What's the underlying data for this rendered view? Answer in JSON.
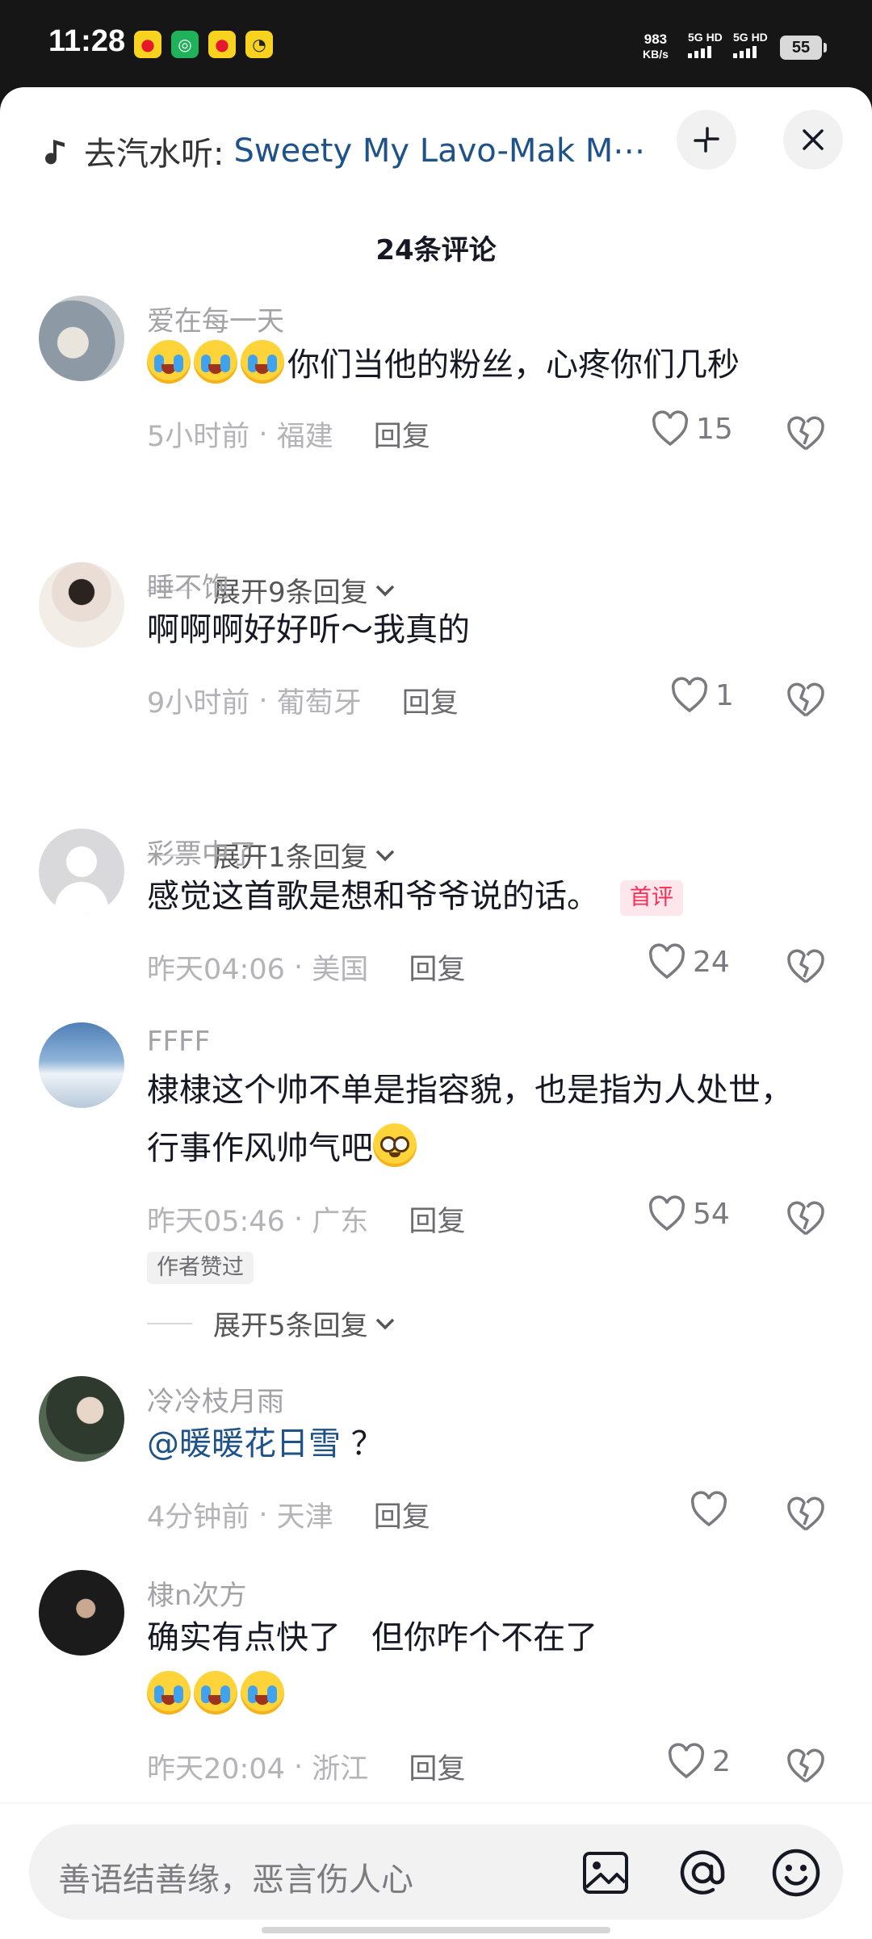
{
  "status_bar": {
    "time": "11:28",
    "net_speed_value": "983",
    "net_speed_unit": "KB/s",
    "sim1": "5G HD",
    "sim2": "5G HD",
    "battery": "55"
  },
  "header": {
    "music_prefix": "去汽水听:",
    "song": "Sweety My Lavo-Mak M⋯",
    "comment_count": "24条评论"
  },
  "comments": [
    {
      "username": "爱在每一天",
      "text": "你们当他的粉丝，心疼你们几秒",
      "time": "5小时前",
      "location": "福建",
      "reply": "回复",
      "likes": "15",
      "expand": "展开9条回复",
      "emoji": "cry-x3-leading"
    },
    {
      "username": "睡不饱",
      "text": "啊啊啊好好听～我真的",
      "time": "9小时前",
      "location": "葡萄牙",
      "reply": "回复",
      "likes": "1",
      "expand": "展开1条回复"
    },
    {
      "username": "彩票中了",
      "text": "感觉这首歌是想和爷爷说的话。",
      "badge": "首评",
      "time": "昨天04:06",
      "location": "美国",
      "reply": "回复",
      "likes": "24"
    },
    {
      "username": "FFFF",
      "text": "棣棣这个帅不单是指容貌，也是指为人处世，行事作风帅气吧",
      "time": "昨天05:46",
      "location": "广东",
      "reply": "回复",
      "likes": "54",
      "author_badge": "作者赞过",
      "expand": "展开5条回复",
      "emoji": "blush-trailing"
    },
    {
      "username": "冷冷枝月雨",
      "mention": "@暖暖花日雪",
      "text": "？",
      "time": "4分钟前",
      "location": "天津",
      "reply": "回复",
      "likes": ""
    },
    {
      "username": "棣n次方",
      "text": "确实有点快了   但你咋个不在了",
      "time": "昨天20:04",
      "location": "浙江",
      "reply": "回复",
      "likes": "2",
      "emoji": "cry-x3-newline"
    }
  ],
  "meta_separator": "·",
  "input": {
    "placeholder": "善语结善缘，恶言伤人心"
  },
  "icons": [
    "music-note-icon",
    "collapse-icon",
    "close-icon",
    "heart-icon",
    "broken-heart-icon",
    "chevron-down-icon",
    "image-icon",
    "at-icon",
    "emoji-icon"
  ],
  "colors": {
    "accent_link": "#1f5289",
    "first_badge": "#fe2c55"
  }
}
